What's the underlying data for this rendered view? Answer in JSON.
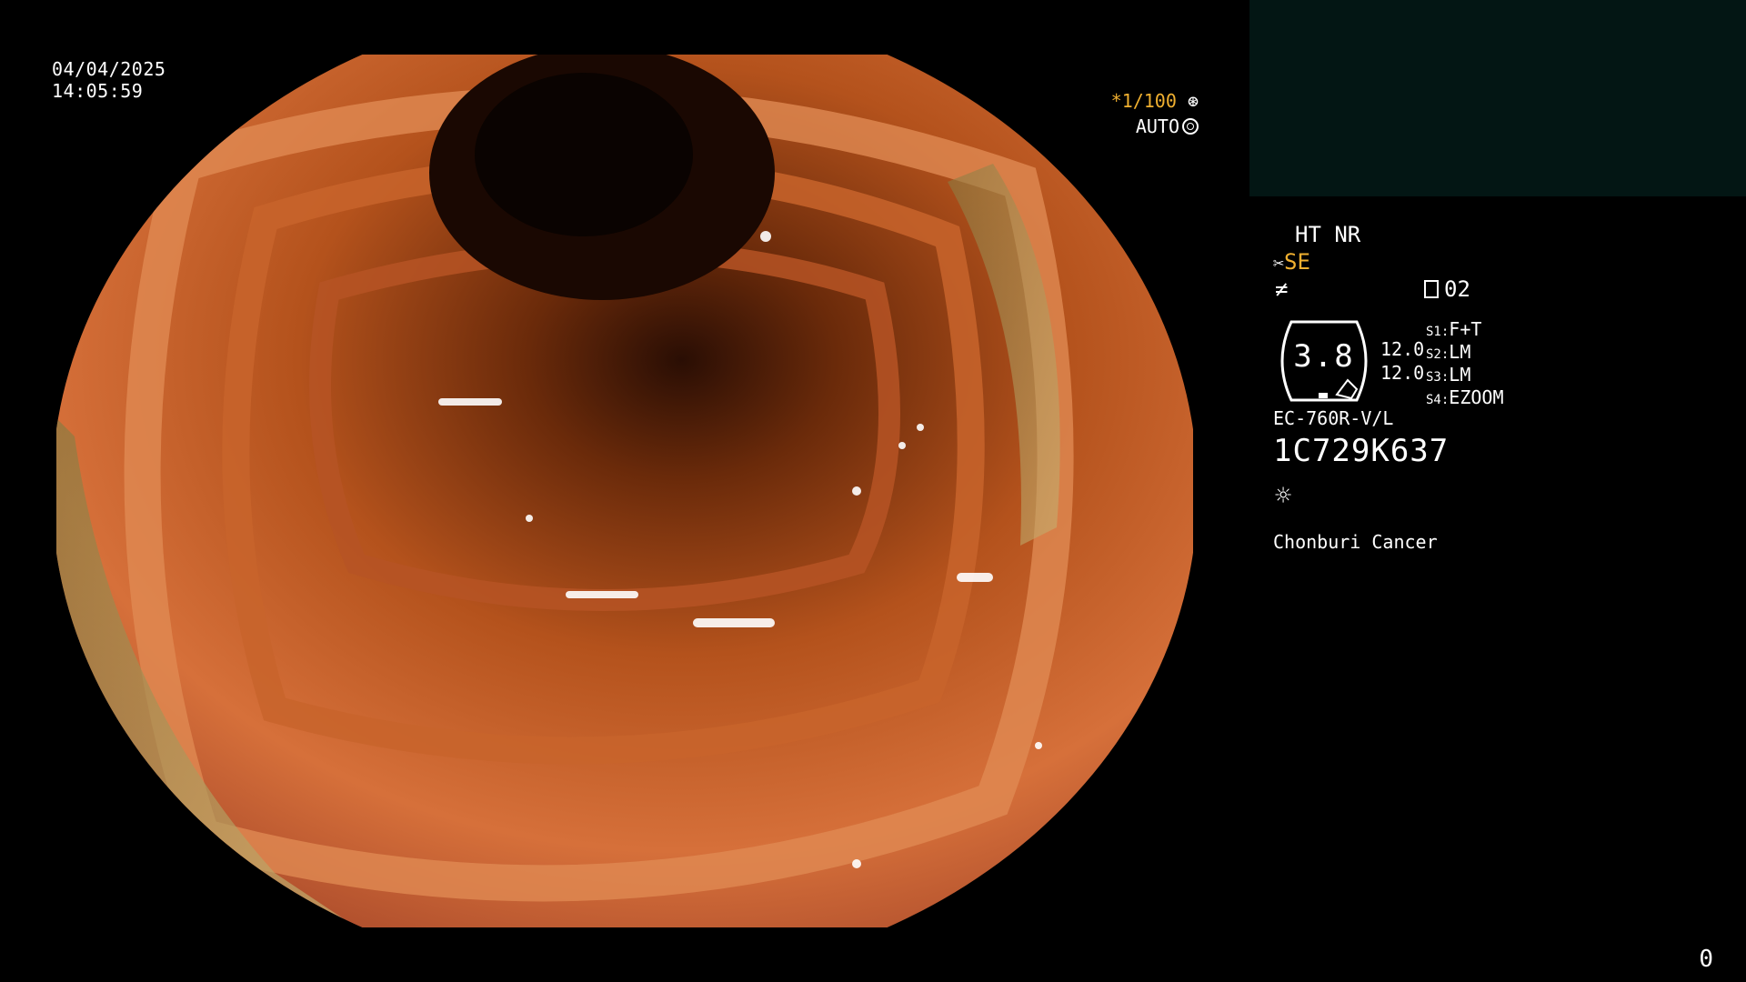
{
  "date": "04/04/2025",
  "time": "14:05:59",
  "shutter": {
    "prefix": "*",
    "value": "1/100"
  },
  "auto_label": "AUTO",
  "modes": "HT NR",
  "se_label": "SE",
  "memory_label": "02",
  "hex_value": "3.8",
  "values": [
    "12.0",
    "12.0"
  ],
  "switches": [
    {
      "key": "S1",
      "value": "F+T"
    },
    {
      "key": "S2",
      "value": "LM"
    },
    {
      "key": "S3",
      "value": "LM"
    },
    {
      "key": "S4",
      "value": "EZOOM"
    }
  ],
  "scope_model": "EC-760R-V/L",
  "serial": "1C729K637",
  "site": "Chonburi Cancer",
  "counter": "0",
  "icons": [
    "aperture-icon",
    "ring-icon",
    "scissors-icon",
    "no-signal-icon",
    "memory-card-icon",
    "sun-icon"
  ]
}
